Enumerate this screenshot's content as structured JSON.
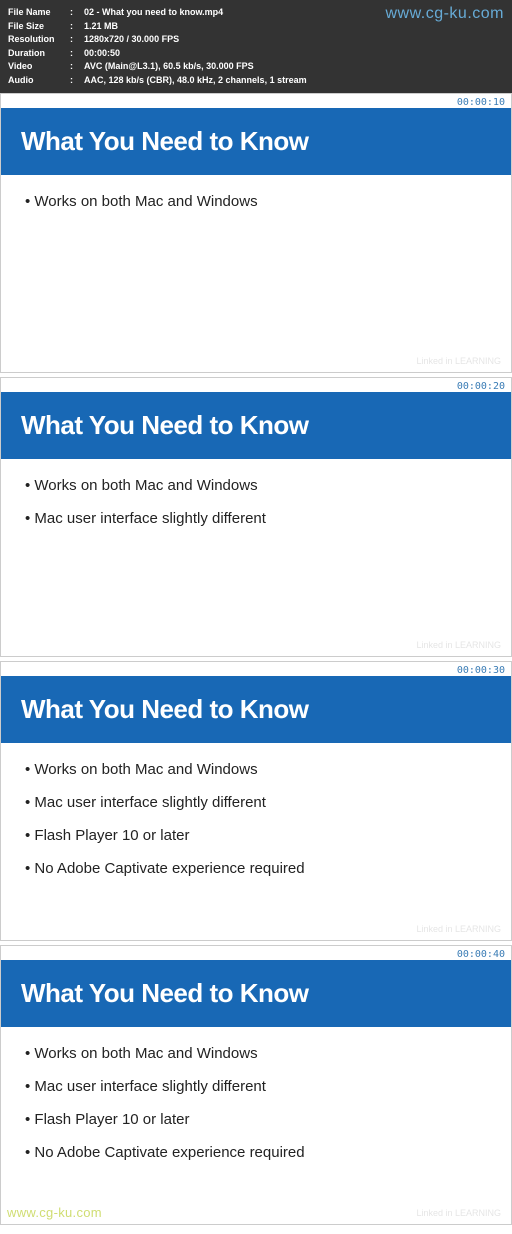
{
  "watermarks": {
    "top": "www.cg-ku.com",
    "bottom": "www.cg-ku.com",
    "linkedin": "Linked in LEARNING"
  },
  "media_info": {
    "rows": [
      {
        "label": "File Name",
        "value": "02 - What you need to know.mp4"
      },
      {
        "label": "File Size",
        "value": "1.21 MB"
      },
      {
        "label": "Resolution",
        "value": "1280x720 / 30.000 FPS"
      },
      {
        "label": "Duration",
        "value": "00:00:50"
      },
      {
        "label": "Video",
        "value": "AVC (Main@L3.1), 60.5 kb/s, 30.000 FPS"
      },
      {
        "label": "Audio",
        "value": "AAC, 128 kb/s (CBR), 48.0 kHz, 2 channels, 1 stream"
      }
    ],
    "separator": ":"
  },
  "slides": [
    {
      "timestamp": "00:00:10",
      "title": "What You Need to Know",
      "bullets": [
        "Works on both Mac and Windows"
      ]
    },
    {
      "timestamp": "00:00:20",
      "title": "What You Need to Know",
      "bullets": [
        "Works on both Mac and Windows",
        "Mac user interface slightly different"
      ]
    },
    {
      "timestamp": "00:00:30",
      "title": "What You Need to Know",
      "bullets": [
        "Works on both Mac and Windows",
        "Mac user interface slightly different",
        "Flash Player 10 or later",
        "No Adobe Captivate experience required"
      ]
    },
    {
      "timestamp": "00:00:40",
      "title": "What You Need to Know",
      "bullets": [
        "Works on both Mac and Windows",
        "Mac user interface slightly different",
        "Flash Player 10 or later",
        "No Adobe Captivate experience required"
      ]
    }
  ]
}
